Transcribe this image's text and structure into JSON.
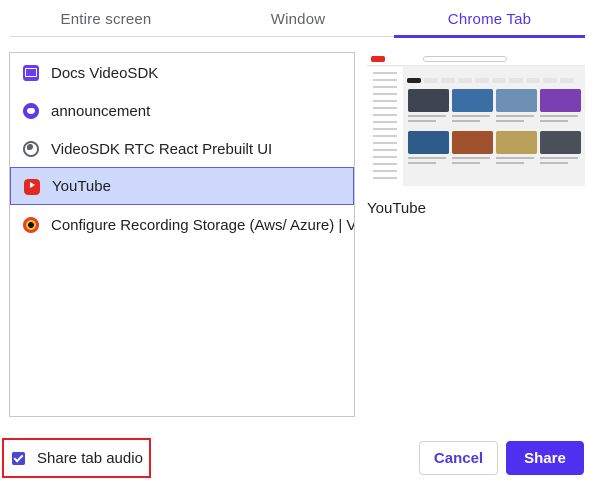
{
  "tabs": [
    {
      "label": "Entire screen",
      "active": false
    },
    {
      "label": "Window",
      "active": false
    },
    {
      "label": "Chrome Tab",
      "active": true
    }
  ],
  "sources": [
    {
      "icon": "docs-calendar-icon",
      "label": "Docs VideoSDK",
      "selected": false
    },
    {
      "icon": "discord-icon",
      "label": "announcement",
      "selected": false
    },
    {
      "icon": "globe-icon",
      "label": "VideoSDK RTC React Prebuilt UI",
      "selected": false
    },
    {
      "icon": "youtube-icon",
      "label": "YouTube",
      "selected": true
    },
    {
      "icon": "recording-icon",
      "label": "Configure Recording Storage (Aws/ Azure) | V",
      "selected": false
    }
  ],
  "preview": {
    "title": "YouTube"
  },
  "share_audio": {
    "label": "Share tab audio",
    "checked": true
  },
  "buttons": {
    "cancel": "Cancel",
    "share": "Share"
  },
  "colors": {
    "accent": "#5335e8",
    "selected_row_bg": "#ced9fb",
    "highlight_border": "#e41e26"
  }
}
